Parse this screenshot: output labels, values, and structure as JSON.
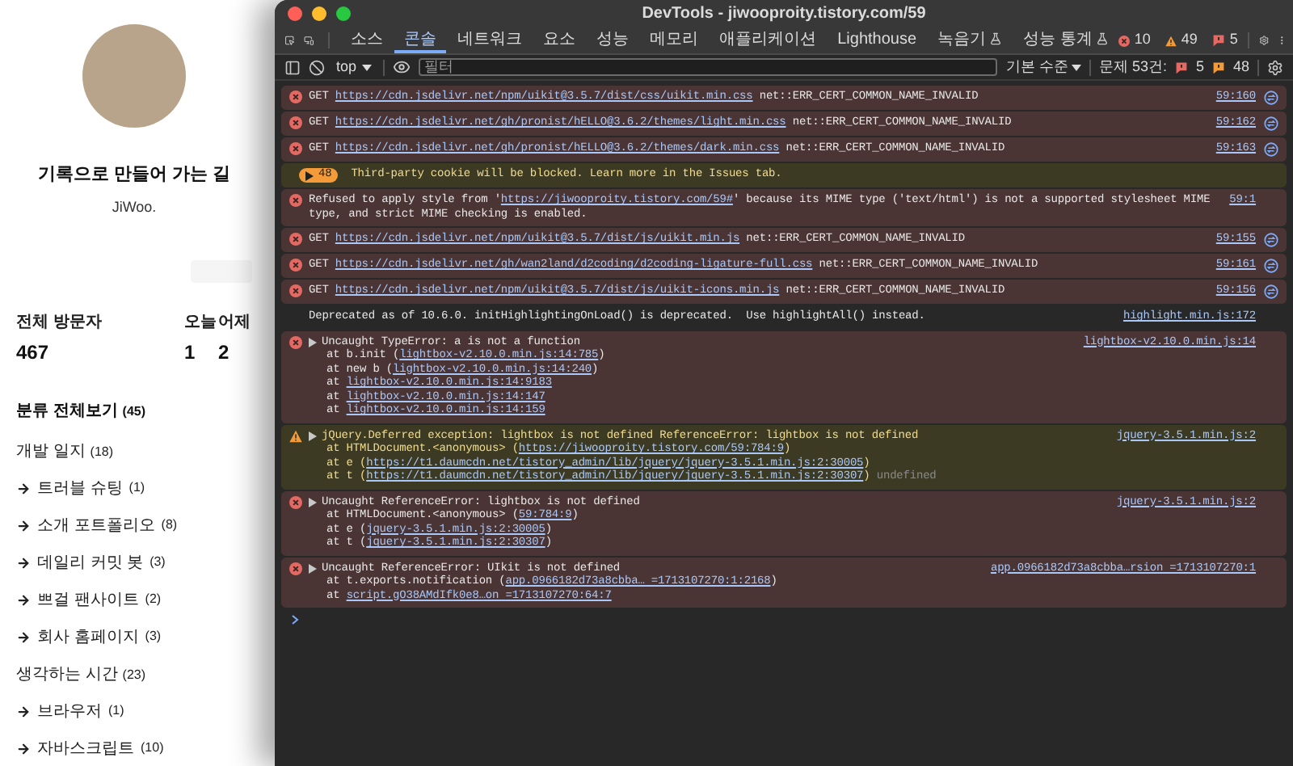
{
  "sidebar": {
    "blog_title": "기록으로 만들어 가는 길",
    "author": "JiWoo.",
    "stats": [
      {
        "label": "전체 방문자",
        "value": "467"
      },
      {
        "label": "오늘",
        "value": "1"
      },
      {
        "label": "어제",
        "value": "2"
      }
    ],
    "categories_header": {
      "name": "분류 전체보기",
      "count": "(45)"
    },
    "categories": [
      {
        "name": "개발 일지",
        "count": "(18)",
        "children": [
          {
            "name": "트러블 슈팅",
            "count": "(1)"
          },
          {
            "name": "소개 포트폴리오",
            "count": "(8)"
          },
          {
            "name": "데일리 커밋 봇",
            "count": "(3)"
          },
          {
            "name": "쁘걸 팬사이트",
            "count": "(2)"
          },
          {
            "name": "회사 홈페이지",
            "count": "(3)"
          }
        ]
      },
      {
        "name": "생각하는 시간",
        "count": "(23)",
        "children": [
          {
            "name": "브라우저",
            "count": "(1)"
          },
          {
            "name": "자바스크립트",
            "count": "(10)"
          }
        ]
      }
    ]
  },
  "devtools": {
    "title": "DevTools - jiwooproity.tistory.com/59",
    "tabs": [
      {
        "label": "소스",
        "selected": false,
        "experimental": false
      },
      {
        "label": "콘솔",
        "selected": true,
        "experimental": false
      },
      {
        "label": "네트워크",
        "selected": false,
        "experimental": false
      },
      {
        "label": "요소",
        "selected": false,
        "experimental": false
      },
      {
        "label": "성능",
        "selected": false,
        "experimental": false
      },
      {
        "label": "메모리",
        "selected": false,
        "experimental": false
      },
      {
        "label": "애플리케이션",
        "selected": false,
        "experimental": false
      },
      {
        "label": "Lighthouse",
        "selected": false,
        "experimental": false
      },
      {
        "label": "녹음기",
        "selected": false,
        "experimental": true
      },
      {
        "label": "성능 통계",
        "selected": false,
        "experimental": true
      }
    ],
    "counts": {
      "errors": "10",
      "warnings": "49",
      "issues": "5"
    },
    "toolbar": {
      "context": "top",
      "filter_placeholder": "필터",
      "level": "기본 수준",
      "issues_label": "문제 53건:",
      "issues_errors": "5",
      "issues_warnings": "48"
    },
    "messages": [
      {
        "kind": "error",
        "expandable": false,
        "lines": [
          [
            {
              "kind": "text",
              "text": "GET "
            },
            {
              "kind": "link",
              "text": "https://cdn.jsdelivr.net/npm/uikit@3.5.7/dist/css/uikit.min.css"
            },
            {
              "kind": "text",
              "text": " net::ERR_CERT_COMMON_NAME_INVALID"
            }
          ]
        ],
        "source": "59:160",
        "network": true
      },
      {
        "kind": "error",
        "expandable": false,
        "lines": [
          [
            {
              "kind": "text",
              "text": "GET "
            },
            {
              "kind": "link",
              "text": "https://cdn.jsdelivr.net/gh/pronist/hELLO@3.6.2/themes/light.min.css"
            },
            {
              "kind": "text",
              "text": " net::ERR_CERT_COMMON_NAME_INVALID"
            }
          ]
        ],
        "source": "59:162",
        "network": true
      },
      {
        "kind": "error",
        "expandable": false,
        "lines": [
          [
            {
              "kind": "text",
              "text": "GET "
            },
            {
              "kind": "link",
              "text": "https://cdn.jsdelivr.net/gh/pronist/hELLO@3.6.2/themes/dark.min.css"
            },
            {
              "kind": "text",
              "text": " net::ERR_CERT_COMMON_NAME_INVALID"
            }
          ]
        ],
        "source": "59:163",
        "network": true
      },
      {
        "kind": "issues",
        "count": "48",
        "lines": [
          [
            {
              "kind": "text",
              "text": "Third-party cookie will be blocked. Learn more in the Issues tab."
            }
          ]
        ]
      },
      {
        "kind": "error",
        "expandable": false,
        "lines": [
          [
            {
              "kind": "text",
              "text": "Refused to apply style from '"
            },
            {
              "kind": "link",
              "text": "https://jiwooproity.tistory.com/59#"
            },
            {
              "kind": "text",
              "text": "' because its MIME type ('text/html') is not a supported stylesheet MIME"
            }
          ],
          [
            {
              "kind": "text",
              "text": "type, and strict MIME checking is enabled."
            }
          ]
        ],
        "source": "59:1",
        "network": false
      },
      {
        "kind": "error",
        "expandable": false,
        "lines": [
          [
            {
              "kind": "text",
              "text": "GET "
            },
            {
              "kind": "link",
              "text": "https://cdn.jsdelivr.net/npm/uikit@3.5.7/dist/js/uikit.min.js"
            },
            {
              "kind": "text",
              "text": " net::ERR_CERT_COMMON_NAME_INVALID"
            }
          ]
        ],
        "source": "59:155",
        "network": true
      },
      {
        "kind": "error",
        "expandable": false,
        "lines": [
          [
            {
              "kind": "text",
              "text": "GET "
            },
            {
              "kind": "link",
              "text": "https://cdn.jsdelivr.net/gh/wan2land/d2coding/d2coding-ligature-full.css"
            },
            {
              "kind": "text",
              "text": " net::ERR_CERT_COMMON_NAME_INVALID"
            }
          ]
        ],
        "source": "59:161",
        "network": true
      },
      {
        "kind": "error",
        "expandable": false,
        "lines": [
          [
            {
              "kind": "text",
              "text": "GET "
            },
            {
              "kind": "link",
              "text": "https://cdn.jsdelivr.net/npm/uikit@3.5.7/dist/js/uikit-icons.min.js"
            },
            {
              "kind": "text",
              "text": " net::ERR_CERT_COMMON_NAME_INVALID"
            }
          ]
        ],
        "source": "59:156",
        "network": true
      },
      {
        "kind": "info",
        "expandable": false,
        "lines": [
          [
            {
              "kind": "text",
              "text": "Deprecated as of 10.6.0. initHighlightingOnLoad() is deprecated.  Use highlightAll() instead."
            }
          ]
        ],
        "source": "highlight.min.js:172",
        "network": false
      },
      {
        "kind": "error",
        "expandable": true,
        "lines": [
          [
            {
              "kind": "text",
              "text": "Uncaught TypeError: a is not a function"
            }
          ]
        ],
        "stack": [
          [
            {
              "kind": "text",
              "text": "at b.init ("
            },
            {
              "kind": "link",
              "text": "lightbox-v2.10.0.min.js:14:785"
            },
            {
              "kind": "text",
              "text": ")"
            }
          ],
          [
            {
              "kind": "text",
              "text": "at new b ("
            },
            {
              "kind": "link",
              "text": "lightbox-v2.10.0.min.js:14:240"
            },
            {
              "kind": "text",
              "text": ")"
            }
          ],
          [
            {
              "kind": "text",
              "text": "at "
            },
            {
              "kind": "link",
              "text": "lightbox-v2.10.0.min.js:14:9183"
            }
          ],
          [
            {
              "kind": "text",
              "text": "at "
            },
            {
              "kind": "link",
              "text": "lightbox-v2.10.0.min.js:14:147"
            }
          ],
          [
            {
              "kind": "text",
              "text": "at "
            },
            {
              "kind": "link",
              "text": "lightbox-v2.10.0.min.js:14:159"
            }
          ]
        ],
        "source": "lightbox-v2.10.0.min.js:14",
        "network": false
      },
      {
        "kind": "warning",
        "expandable": true,
        "lines": [
          [
            {
              "kind": "text",
              "text": "jQuery.Deferred exception: lightbox is not defined ReferenceError: lightbox is not defined"
            }
          ]
        ],
        "stack": [
          [
            {
              "kind": "text",
              "text": "at HTMLDocument.<anonymous> ("
            },
            {
              "kind": "link",
              "text": "https://jiwooproity.tistory.com/59:784:9"
            },
            {
              "kind": "text",
              "text": ")"
            }
          ],
          [
            {
              "kind": "text",
              "text": "at e ("
            },
            {
              "kind": "link",
              "text": "https://t1.daumcdn.net/tistory_admin/lib/jquery/jquery-3.5.1.min.js:2:30005"
            },
            {
              "kind": "text",
              "text": ")"
            }
          ],
          [
            {
              "kind": "text",
              "text": "at t ("
            },
            {
              "kind": "link",
              "text": "https://t1.daumcdn.net/tistory_admin/lib/jquery/jquery-3.5.1.min.js:2:30307"
            },
            {
              "kind": "text",
              "text": ")"
            },
            {
              "kind": "dim",
              "text": " undefined"
            }
          ]
        ],
        "source": "jquery-3.5.1.min.js:2",
        "network": false
      },
      {
        "kind": "error",
        "expandable": true,
        "lines": [
          [
            {
              "kind": "text",
              "text": "Uncaught ReferenceError: lightbox is not defined"
            }
          ]
        ],
        "stack": [
          [
            {
              "kind": "text",
              "text": "at HTMLDocument.<anonymous> ("
            },
            {
              "kind": "link",
              "text": "59:784:9"
            },
            {
              "kind": "text",
              "text": ")"
            }
          ],
          [
            {
              "kind": "text",
              "text": "at e ("
            },
            {
              "kind": "link",
              "text": "jquery-3.5.1.min.js:2:30005"
            },
            {
              "kind": "text",
              "text": ")"
            }
          ],
          [
            {
              "kind": "text",
              "text": "at t ("
            },
            {
              "kind": "link",
              "text": "jquery-3.5.1.min.js:2:30307"
            },
            {
              "kind": "text",
              "text": ")"
            }
          ]
        ],
        "source": "jquery-3.5.1.min.js:2",
        "network": false
      },
      {
        "kind": "error",
        "expandable": true,
        "lines": [
          [
            {
              "kind": "text",
              "text": "Uncaught ReferenceError: UIkit is not defined"
            }
          ]
        ],
        "stack": [
          [
            {
              "kind": "text",
              "text": "at t.exports.notification ("
            },
            {
              "kind": "link",
              "text": "app.0966182d73a8cbba… =1713107270:1:2168"
            },
            {
              "kind": "text",
              "text": ")"
            }
          ],
          [
            {
              "kind": "text",
              "text": "at "
            },
            {
              "kind": "link",
              "text": "script.gO38AMdIfk0e8…on =1713107270:64:7"
            }
          ]
        ],
        "source": "app.0966182d73a8cbba…rsion =1713107270:1",
        "network": false
      }
    ]
  }
}
